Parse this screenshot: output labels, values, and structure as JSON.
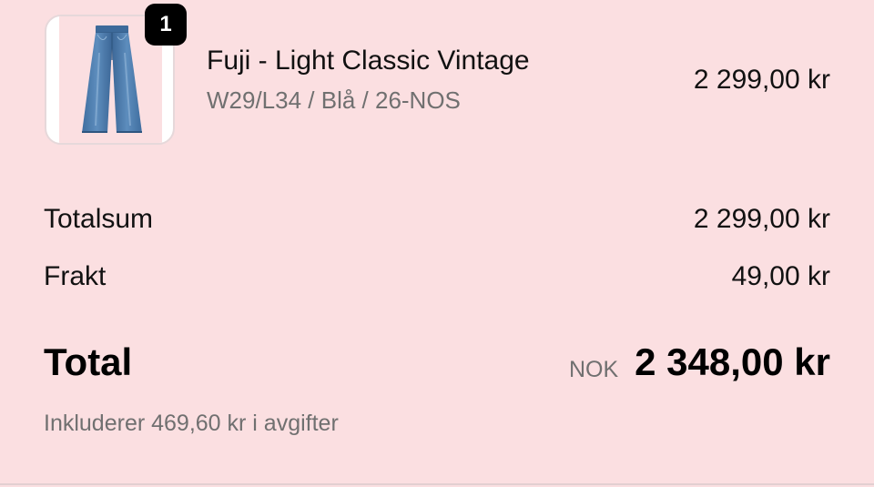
{
  "cart": {
    "items": [
      {
        "quantity": "1",
        "name": "Fuji - Light Classic Vintage",
        "variant": "W29/L34 / Blå / 26-NOS",
        "price": "2 299,00 kr",
        "image_icon": "jeans-product-image"
      }
    ]
  },
  "summary": {
    "subtotal_label": "Totalsum",
    "subtotal_value": "2 299,00 kr",
    "shipping_label": "Frakt",
    "shipping_value": "49,00 kr",
    "total_label": "Total",
    "currency": "NOK",
    "total_value": "2 348,00 kr",
    "tax_note": "Inkluderer 469,60 kr i avgifter"
  },
  "colors": {
    "background": "#fbdfe1",
    "text": "#111111",
    "muted_text": "#707070",
    "badge": "#000000",
    "denim": "#4a78aa"
  }
}
